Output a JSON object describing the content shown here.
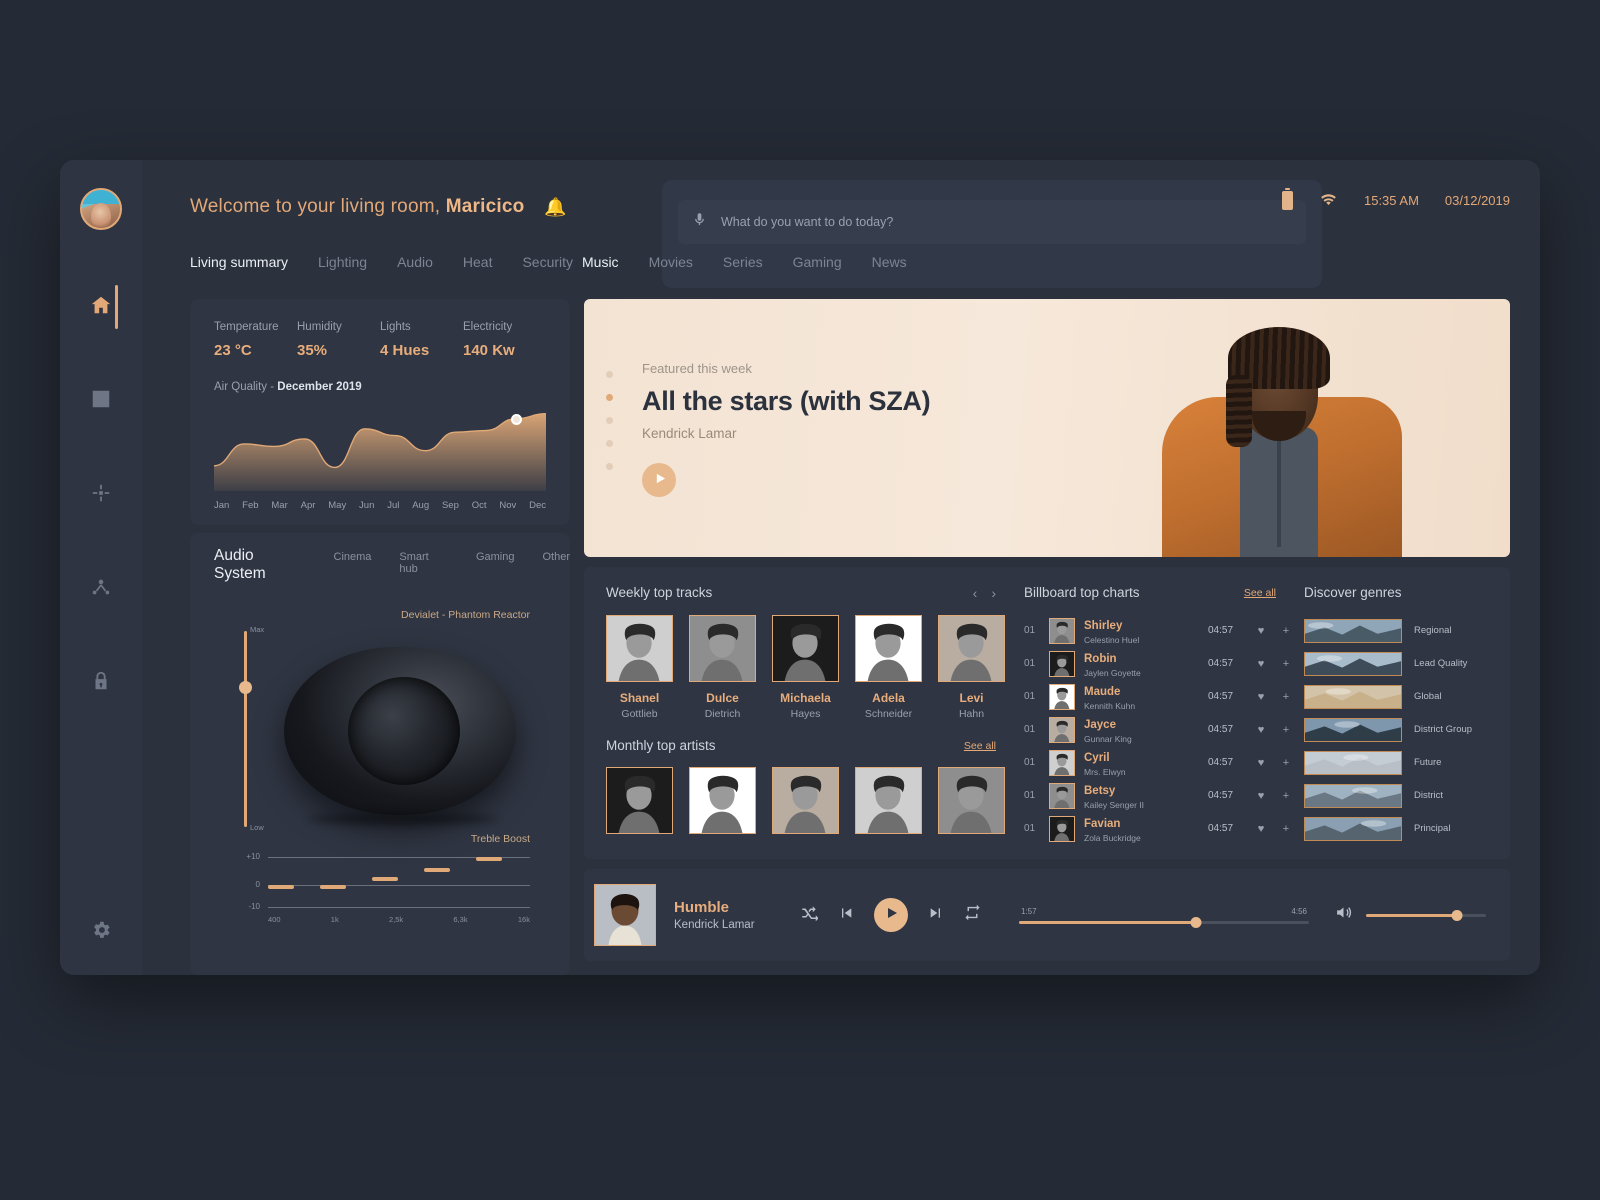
{
  "header": {
    "welcome_prefix": "Welcome to your living room, ",
    "user_name": "Maricico",
    "bell_icon": "bell-icon",
    "search_placeholder": "What do you want to do today?",
    "time": "15:35 AM",
    "date": "03/12/2019",
    "battery_icon": "battery-icon",
    "wifi_icon": "wifi-icon"
  },
  "sidebar": {
    "avatar": "user-avatar",
    "items": [
      {
        "icon": "home-icon",
        "name": "home",
        "active": true
      },
      {
        "icon": "film-icon",
        "name": "media",
        "active": false
      },
      {
        "icon": "devices-icon",
        "name": "devices",
        "active": false
      },
      {
        "icon": "network-icon",
        "name": "network",
        "active": false
      },
      {
        "icon": "lock-icon",
        "name": "security",
        "active": false
      }
    ],
    "settings": {
      "icon": "gear-icon",
      "name": "settings"
    }
  },
  "left_tabs": [
    {
      "label": "Living summary",
      "active": true
    },
    {
      "label": "Lighting",
      "active": false
    },
    {
      "label": "Audio",
      "active": false
    },
    {
      "label": "Heat",
      "active": false
    },
    {
      "label": "Security",
      "active": false
    }
  ],
  "right_tabs": [
    {
      "label": "Music",
      "active": true
    },
    {
      "label": "Movies",
      "active": false
    },
    {
      "label": "Series",
      "active": false
    },
    {
      "label": "Gaming",
      "active": false
    },
    {
      "label": "News",
      "active": false
    }
  ],
  "summary": {
    "stats": [
      {
        "label": "Temperature",
        "value": "23 °C"
      },
      {
        "label": "Humidity",
        "value": "35%"
      },
      {
        "label": "Lights",
        "value": "4 Hues"
      },
      {
        "label": "Electricity",
        "value": "140 Kw"
      }
    ],
    "air_quality_label": "Air Quality - ",
    "air_quality_period": "December 2019"
  },
  "chart_data": {
    "type": "area",
    "title": "Air Quality - December 2019",
    "categories": [
      "Jan",
      "Feb",
      "Mar",
      "Apr",
      "May",
      "Jun",
      "Jul",
      "Aug",
      "Sep",
      "Oct",
      "Nov",
      "Dec"
    ],
    "values": [
      30,
      56,
      53,
      62,
      28,
      74,
      66,
      48,
      70,
      72,
      86,
      92
    ],
    "xlabel": "",
    "ylabel": "",
    "ylim": [
      0,
      100
    ],
    "grid": false,
    "legend": "none",
    "highlight_point": {
      "category": "Nov",
      "value": 86
    },
    "accent_color": "#e0a977"
  },
  "audio": {
    "tabs": [
      {
        "label": "Audio System",
        "active": true
      },
      {
        "label": "Cinema",
        "active": false
      },
      {
        "label": "Smart hub",
        "active": false
      },
      {
        "label": "Gaming",
        "active": false
      },
      {
        "label": "Other",
        "active": false
      }
    ],
    "device_name": "Devialet - Phantom Reactor",
    "volume_max_label": "Max",
    "volume_min_label": "Low",
    "eq_title": "Treble Boost",
    "eq_axis_labels": [
      "+10",
      "0",
      "-10"
    ],
    "eq_frequencies": [
      "400",
      "1k",
      "2,5k",
      "6,3k",
      "16k"
    ],
    "eq_values": [
      0,
      0,
      3,
      6,
      10
    ]
  },
  "hero": {
    "kicker": "Featured this week",
    "title": "All the stars (with SZA)",
    "artist": "Kendrick Lamar",
    "play_icon": "play-icon",
    "dots": 5,
    "active_dot": 1
  },
  "weekly": {
    "title": "Weekly top tracks",
    "prev_icon": "chevron-left-icon",
    "next_icon": "chevron-right-icon",
    "tracks": [
      {
        "first": "Shanel",
        "last": "Gottlieb"
      },
      {
        "first": "Dulce",
        "last": "Dietrich"
      },
      {
        "first": "Michaela",
        "last": "Hayes"
      },
      {
        "first": "Adela",
        "last": "Schneider"
      },
      {
        "first": "Levi",
        "last": "Hahn"
      }
    ]
  },
  "monthly": {
    "title": "Monthly top artists",
    "see_all": "See all",
    "count": 5
  },
  "billboard": {
    "title": "Billboard top charts",
    "see_all": "See all",
    "like_icon": "heart-icon",
    "add_icon": "plus-icon",
    "rows": [
      {
        "index": "01",
        "title": "Shirley",
        "artist": "Celestino Huel",
        "duration": "04:57"
      },
      {
        "index": "01",
        "title": "Robin",
        "artist": "Jaylen Goyette",
        "duration": "04:57"
      },
      {
        "index": "01",
        "title": "Maude",
        "artist": "Kennith Kuhn",
        "duration": "04:57"
      },
      {
        "index": "01",
        "title": "Jayce",
        "artist": "Gunnar King",
        "duration": "04:57"
      },
      {
        "index": "01",
        "title": "Cyril",
        "artist": "Mrs. Elwyn",
        "duration": "04:57"
      },
      {
        "index": "01",
        "title": "Betsy",
        "artist": "Kailey Senger II",
        "duration": "04:57"
      },
      {
        "index": "01",
        "title": "Favian",
        "artist": "Zola Buckridge",
        "duration": "04:57"
      }
    ]
  },
  "genres": {
    "title": "Discover genres",
    "items": [
      {
        "label": "Regional"
      },
      {
        "label": "Lead Quality"
      },
      {
        "label": "Global"
      },
      {
        "label": "District Group"
      },
      {
        "label": "Future"
      },
      {
        "label": "District"
      },
      {
        "label": "Principal"
      }
    ]
  },
  "player": {
    "title": "Humble",
    "artist": "Kendrick Lamar",
    "shuffle_icon": "shuffle-icon",
    "prev_icon": "previous-icon",
    "play_icon": "play-icon",
    "next_icon": "next-icon",
    "repeat_icon": "repeat-icon",
    "current_time": "1:57",
    "total_time": "4:56",
    "volume_icon": "volume-icon"
  }
}
